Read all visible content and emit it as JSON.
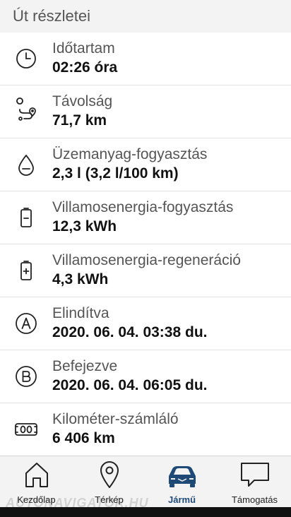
{
  "header": {
    "title": "Út részletei"
  },
  "rows": [
    {
      "label": "Időtartam",
      "value": "02:26 óra",
      "icon": "clock-icon"
    },
    {
      "label": "Távolság",
      "value": "71,7 km",
      "icon": "route-icon"
    },
    {
      "label": "Üzemanyag-fogyasztás",
      "value": "2,3 l (3,2 l/100 km)",
      "icon": "fuel-drop-icon"
    },
    {
      "label": "Villamosenergia-fogyasztás",
      "value": "12,3 kWh",
      "icon": "battery-minus-icon"
    },
    {
      "label": "Villamosenergia-regeneráció",
      "value": "4,3 kWh",
      "icon": "battery-plus-icon"
    },
    {
      "label": "Elindítva",
      "value": "2020. 06. 04. 03:38 du.",
      "icon": "circle-a-icon"
    },
    {
      "label": "Befejezve",
      "value": "2020. 06. 04. 06:05 du.",
      "icon": "circle-b-icon"
    },
    {
      "label": "Kilométer-számláló",
      "value": "6 406 km",
      "icon": "odometer-icon"
    }
  ],
  "tabs": [
    {
      "label": "Kezdőlap",
      "icon": "home-icon",
      "active": false
    },
    {
      "label": "Térkép",
      "icon": "map-pin-icon",
      "active": false
    },
    {
      "label": "Jármű",
      "icon": "car-icon",
      "active": true
    },
    {
      "label": "Támogatás",
      "icon": "chat-icon",
      "active": false
    }
  ],
  "watermark": "AUTONAVIGATOR.HU",
  "colors": {
    "accent": "#1f4a78",
    "icon_stroke": "#222222",
    "background": "#f3f3f3"
  }
}
